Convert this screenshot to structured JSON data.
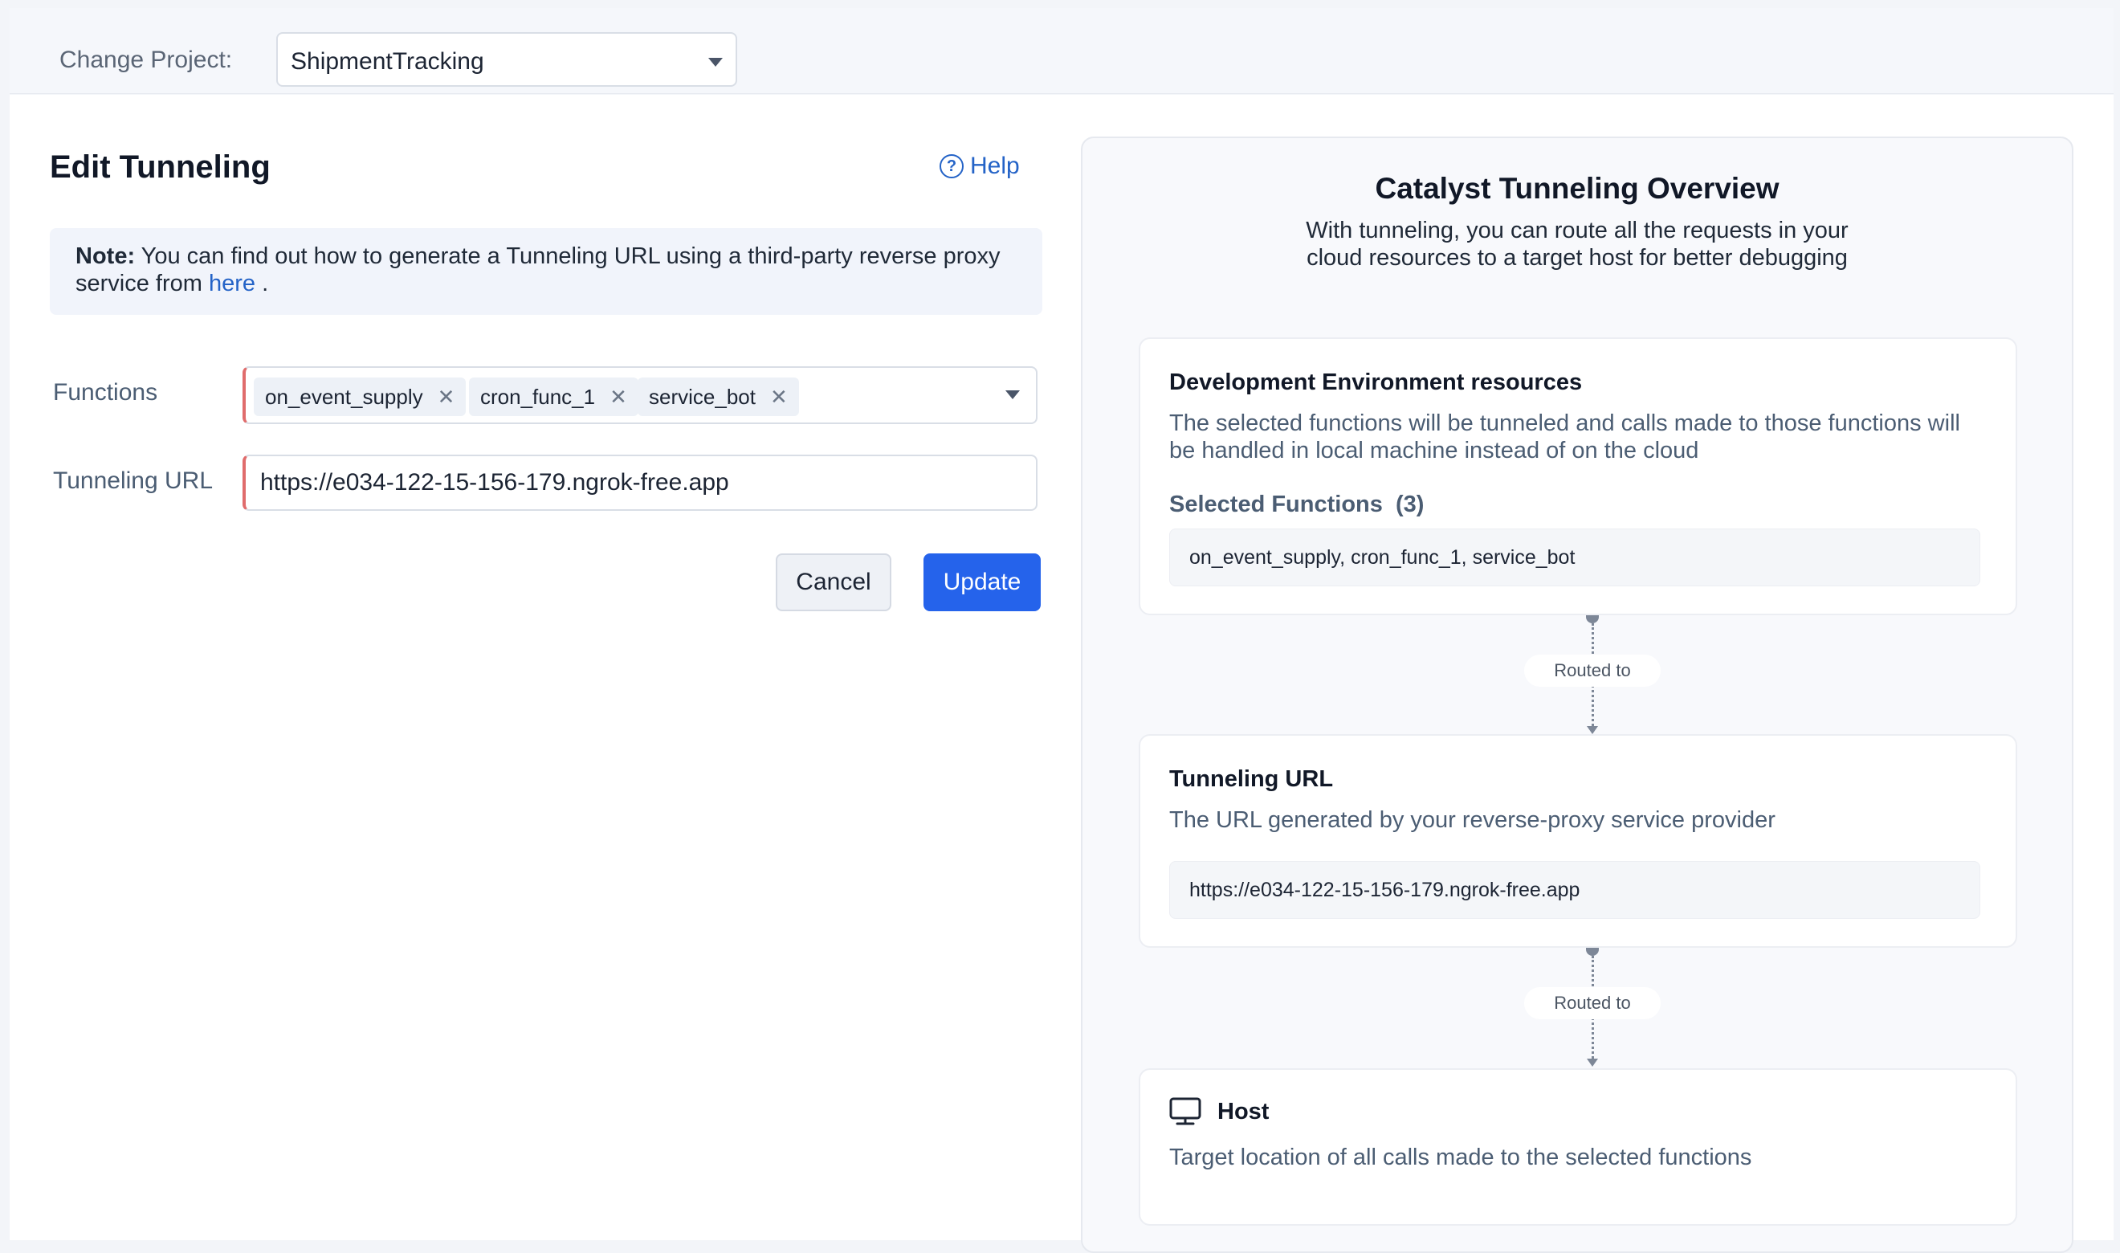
{
  "project": {
    "label": "Change Project:",
    "selected": "ShipmentTracking"
  },
  "editor": {
    "title": "Edit Tunneling",
    "help_label": "Help",
    "note_bold": "Note:",
    "note_text": " You can find out how to generate a Tunneling URL using a third-party reverse proxy service from ",
    "note_link": "here",
    "note_end": " .",
    "functions_label": "Functions",
    "selected_functions": [
      "on_event_supply",
      "cron_func_1",
      "service_bot"
    ],
    "tunneling_label": "Tunneling URL",
    "tunneling_url": "https://e034-122-15-156-179.ngrok-free.app",
    "cancel_label": "Cancel",
    "update_label": "Update"
  },
  "overview": {
    "title": "Catalyst Tunneling Overview",
    "subtitle": "With tunneling, you can route all the requests in your cloud resources to a target host for better debugging",
    "dev_card": {
      "title": "Development Environment resources",
      "desc": "The selected functions will be tunneled and calls made to those functions will be handled in local machine instead of on the cloud",
      "selected_label": "Selected Functions",
      "selected_count": "(3)",
      "selected_value": "on_event_supply, cron_func_1, service_bot"
    },
    "routed_label_1": "Routed to",
    "url_card": {
      "title": "Tunneling URL",
      "desc": "The URL generated by your reverse-proxy service provider",
      "value": "https://e034-122-15-156-179.ngrok-free.app"
    },
    "routed_label_2": "Routed to",
    "host_card": {
      "title": "Host",
      "desc": "Target location of all calls made to the selected functions",
      "icon": "monitor-icon"
    }
  },
  "colors": {
    "accent": "#2563eb",
    "link": "#2463c7",
    "required_marker": "#e06c6c"
  }
}
